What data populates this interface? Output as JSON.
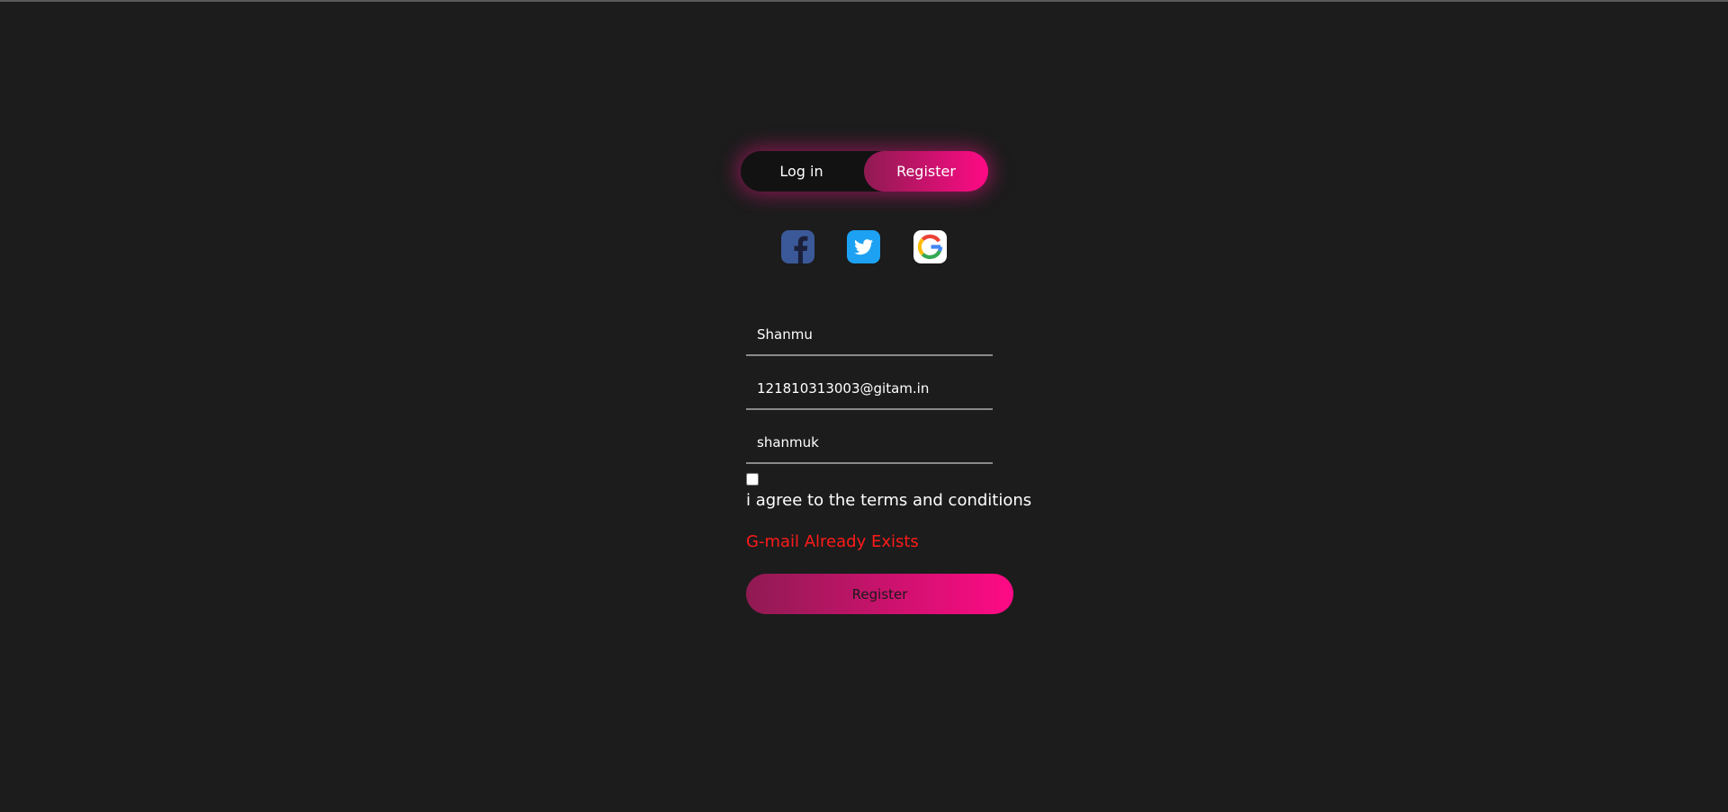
{
  "toggle": {
    "login_label": "Log in",
    "register_label": "Register",
    "active": "Register"
  },
  "social": {
    "icons": [
      "facebook-icon",
      "twitter-icon",
      "google-icon"
    ]
  },
  "form": {
    "name_value": "Shanmu",
    "email_value": "121810313003@gitam.in",
    "password_value": "shanmuk",
    "agree_checked": false,
    "agree_label": "i agree to the terms and conditions",
    "error_message": "G-mail Already Exists",
    "submit_label": "Register"
  },
  "colors": {
    "background": "#1c1c1c",
    "accent_start": "#8f1b52",
    "accent_end": "#ff0a85",
    "error": "#ff1a1a",
    "facebook": "#3b5998",
    "twitter": "#1da1f2"
  }
}
